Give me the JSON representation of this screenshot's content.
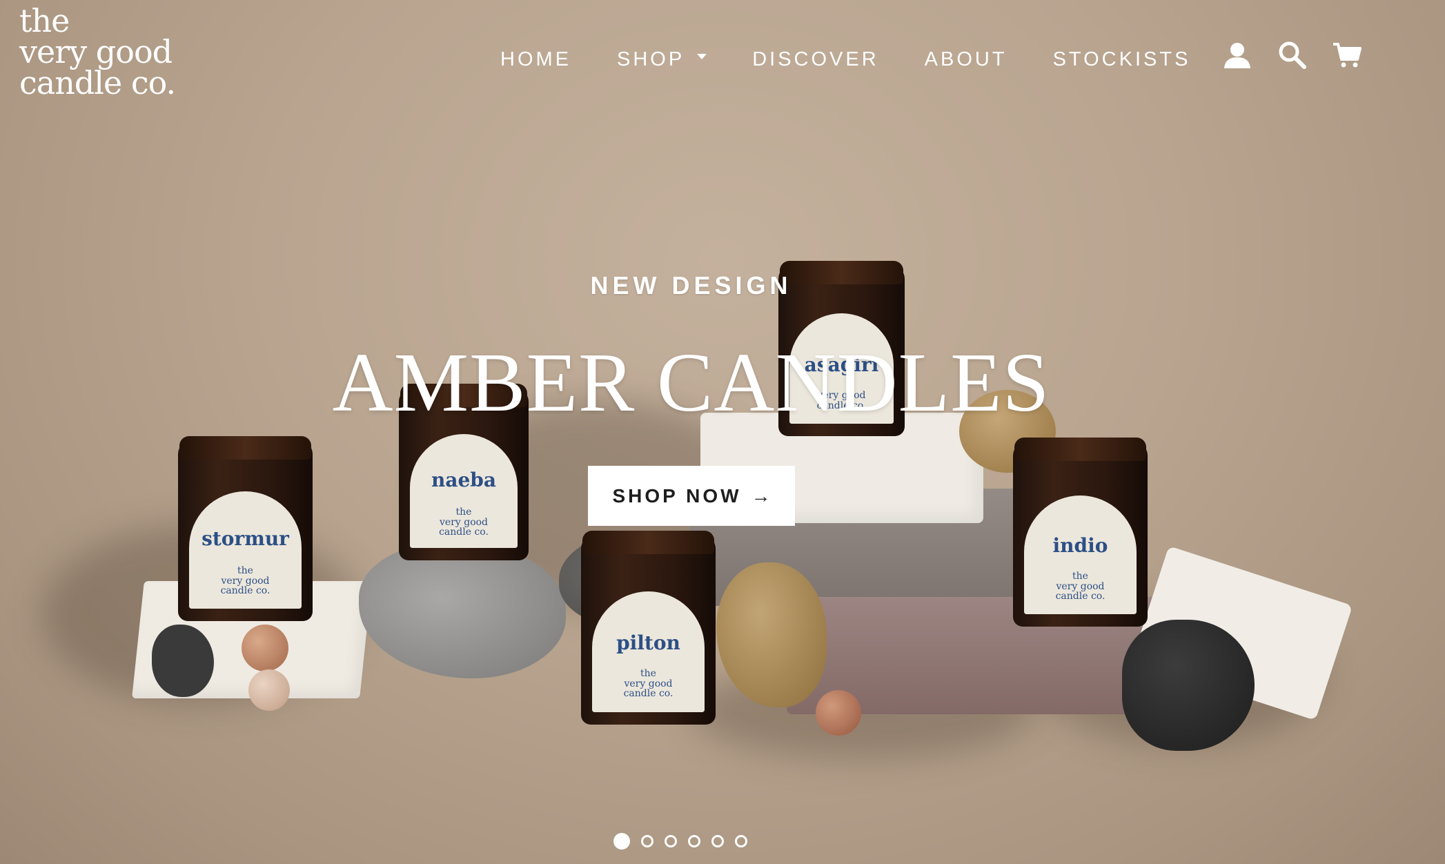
{
  "brand": {
    "logo_lines": [
      "the",
      "very good",
      "candle co."
    ]
  },
  "nav": {
    "items": [
      {
        "label": "HOME"
      },
      {
        "label": "SHOP"
      },
      {
        "label": "DISCOVER"
      },
      {
        "label": "ABOUT"
      },
      {
        "label": "STOCKISTS"
      }
    ],
    "icons": [
      "account-icon",
      "search-icon",
      "cart-icon"
    ]
  },
  "hero": {
    "eyebrow": "NEW DESIGN",
    "headline": "AMBER CANDLES",
    "cta_label": "SHOP NOW",
    "cta_arrow": "→",
    "slides_total": 6,
    "active_slide": 1
  },
  "jars": [
    {
      "name": "stormur",
      "brand": [
        "the",
        "very good",
        "candle co."
      ]
    },
    {
      "name": "naeba",
      "brand": [
        "the",
        "very good",
        "candle co."
      ]
    },
    {
      "name": "asagiri",
      "brand": [
        "very good",
        "candle co."
      ]
    },
    {
      "name": "pilton",
      "brand": [
        "the",
        "very good",
        "candle co."
      ]
    },
    {
      "name": "indio",
      "brand": [
        "the",
        "very good",
        "candle co."
      ]
    }
  ],
  "colors": {
    "background": "#b8a48f",
    "label_text": "#2c4f86",
    "jar_glass": "#2a170e"
  }
}
